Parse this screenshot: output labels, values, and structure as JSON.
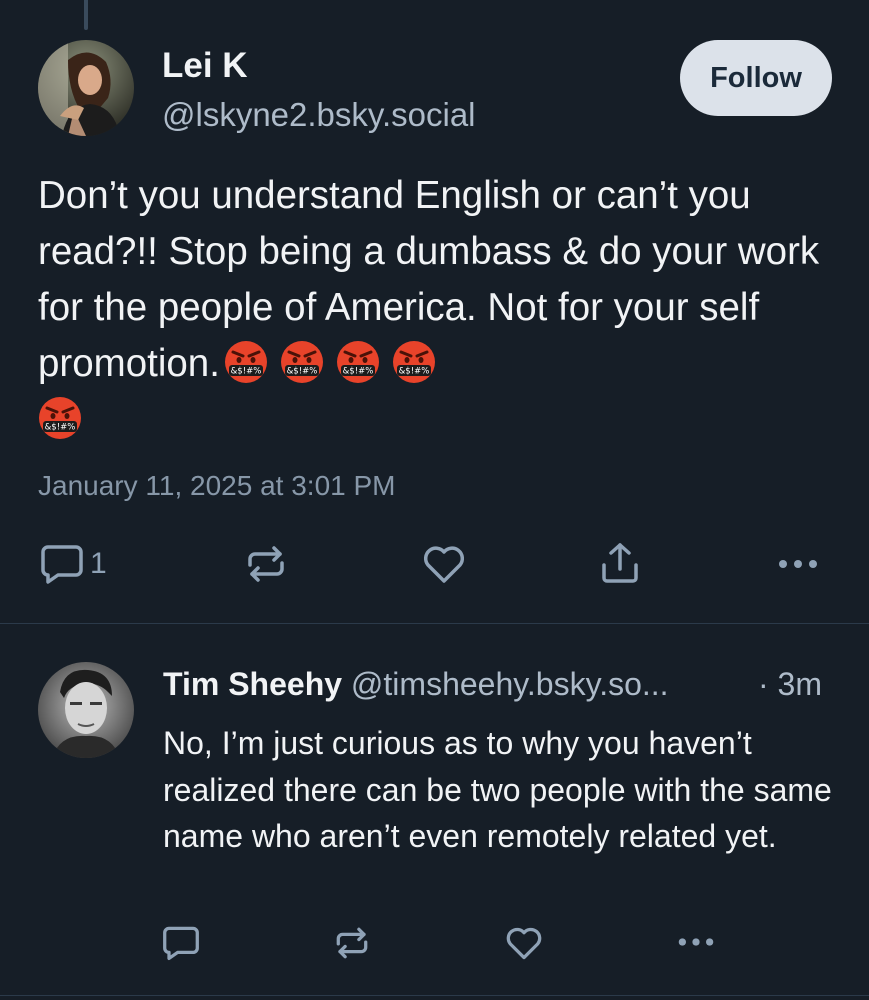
{
  "post": {
    "author_name": "Lei K",
    "author_handle": "@lskyne2.bsky.social",
    "follow_label": "Follow",
    "text": "Don’t you understand English or can’t you read?!!  Stop being a dumbass & do your work for the people of America. Not for your self promotion.",
    "emoji_count": 5,
    "emoji_symbol_text": "&$!#%",
    "timestamp": "January 11, 2025 at 3:01 PM",
    "reply_count": "1"
  },
  "reply": {
    "author_name": "Tim Sheehy",
    "author_handle": "@timsheehy.bsky.so...",
    "time_ago": "· 3m",
    "text": "No, I’m just curious as to why you haven’t realized there can be two people with the same name who aren’t even remotely related yet."
  },
  "icons": {
    "reply": "reply-bubble-icon",
    "repost": "repost-icon",
    "like": "heart-icon",
    "share": "share-icon",
    "more": "more-dots-icon"
  },
  "colors": {
    "background": "#161e27",
    "text": "#f1f3f5",
    "muted": "#8797a8",
    "icon": "#8fa2b6",
    "follow_bg": "#dce2ea",
    "follow_text": "#1b2a3a"
  }
}
